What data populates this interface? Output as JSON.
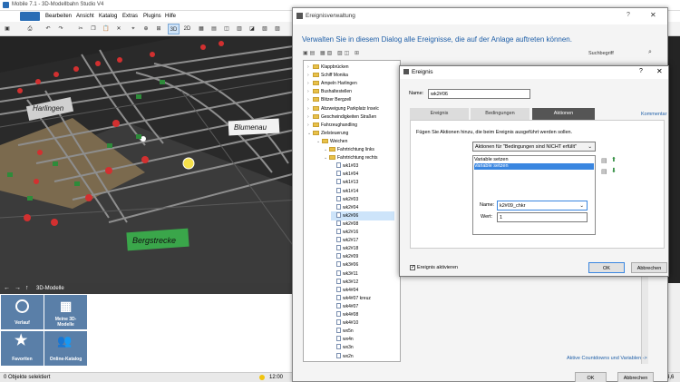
{
  "main": {
    "title": "Mobile 7.1 - 3D-Modellbahn Studio V4",
    "menu": [
      "Bearbeiten",
      "Ansicht",
      "Katalog",
      "Extras",
      "Plugins",
      "Hilfe"
    ],
    "toolbar": {
      "view3d": "3D",
      "view2d": "2D"
    },
    "scene_labels": {
      "harlingen": "Harlingen",
      "blumenau": "Blumenau",
      "bergstrecke": "Bergstrecke"
    },
    "nav_title": "3D-Modelle",
    "tiles": [
      {
        "label": "Verlauf",
        "icon": "clock-icon"
      },
      {
        "label": "Meine 3D-Modelle",
        "icon": "grid-icon"
      },
      {
        "label": "Favoriten",
        "icon": "star-icon"
      },
      {
        "label": "Online-Katalog",
        "icon": "users-icon"
      }
    ],
    "status": {
      "selected": "0 Objekte selektiert",
      "time": "12:00",
      "zoom": "4,6"
    }
  },
  "dialog": {
    "title": "Ereignisverwaltung",
    "heading": "Verwalten Sie in diesem Dialog alle Ereignisse, die auf der Anlage auftreten können.",
    "search_label": "Suchbegriff",
    "tree": [
      {
        "label": "Klappbrücken",
        "level": 1,
        "type": "folder"
      },
      {
        "label": "Schiff Monika",
        "level": 1,
        "type": "folder"
      },
      {
        "label": "Ampeln Harlingen",
        "level": 1,
        "type": "folder"
      },
      {
        "label": "Bushaltestellen",
        "level": 1,
        "type": "folder"
      },
      {
        "label": "Blitzer Bergzell",
        "level": 1,
        "type": "folder"
      },
      {
        "label": "Abzweigung Parkplatz Inselc",
        "level": 1,
        "type": "folder"
      },
      {
        "label": "Geschwindigkeiten Straßen",
        "level": 1,
        "type": "folder"
      },
      {
        "label": "Fahrzeughandling",
        "level": 1,
        "type": "folder"
      },
      {
        "label": "Zielsteuerung",
        "level": 1,
        "type": "folder"
      },
      {
        "label": "Weichen",
        "level": 2,
        "type": "folder"
      },
      {
        "label": "Fahrtrichtung links",
        "level": 3,
        "type": "folder"
      },
      {
        "label": "Fahrtrichtung rechts",
        "level": 3,
        "type": "folder"
      },
      {
        "label": "wk1#03",
        "level": 4,
        "type": "file"
      },
      {
        "label": "wk1#04",
        "level": 4,
        "type": "file"
      },
      {
        "label": "wk1#13",
        "level": 4,
        "type": "file"
      },
      {
        "label": "wk1#14",
        "level": 4,
        "type": "file"
      },
      {
        "label": "wk2#03",
        "level": 4,
        "type": "file"
      },
      {
        "label": "wk2#04",
        "level": 4,
        "type": "file"
      },
      {
        "label": "wk2#06",
        "level": 4,
        "type": "file",
        "selected": true
      },
      {
        "label": "wk2#08",
        "level": 4,
        "type": "file"
      },
      {
        "label": "wk2#16",
        "level": 4,
        "type": "file"
      },
      {
        "label": "wk2#17",
        "level": 4,
        "type": "file"
      },
      {
        "label": "wk2#18",
        "level": 4,
        "type": "file"
      },
      {
        "label": "wk2#09",
        "level": 4,
        "type": "file"
      },
      {
        "label": "wk3#06",
        "level": 4,
        "type": "file"
      },
      {
        "label": "wk3#11",
        "level": 4,
        "type": "file"
      },
      {
        "label": "wk3#12",
        "level": 4,
        "type": "file"
      },
      {
        "label": "wk4#04",
        "level": 4,
        "type": "file"
      },
      {
        "label": "wk4#07 kreuz",
        "level": 4,
        "type": "file"
      },
      {
        "label": "wk4#07",
        "level": 4,
        "type": "file"
      },
      {
        "label": "wk4#08",
        "level": 4,
        "type": "file"
      },
      {
        "label": "wk4#10",
        "level": 4,
        "type": "file"
      },
      {
        "label": "wx5n",
        "level": 4,
        "type": "file"
      },
      {
        "label": "wx4n",
        "level": 4,
        "type": "file"
      },
      {
        "label": "wx3n",
        "level": 4,
        "type": "file"
      },
      {
        "label": "wx2n",
        "level": 4,
        "type": "file"
      }
    ],
    "link": "Aktive Countdowns und Variablen ->",
    "ok": "OK",
    "cancel": "Abbrechen"
  },
  "event": {
    "title": "Ereignis",
    "name_label": "Name:",
    "name_value": "wk2#06",
    "tabs": [
      "Ereignis",
      "Bedingungen",
      "Aktionen"
    ],
    "comment_link": "Kommentar",
    "hint": "Fügen Sie Aktionen hinzu, die beim Ereignis ausgeführt werden sollen.",
    "dropdown": "Aktionen für \"Bedingungen sind NICHT erfüllt\"",
    "actions": [
      "Variable setzen",
      "Variable setzen"
    ],
    "var_name_label": "Name:",
    "var_name_value": "k2#09_chkr",
    "value_label": "Wert:",
    "value_value": "1",
    "active_label": "Ereignis aktivieren",
    "ok": "OK",
    "cancel": "Abbrechen"
  }
}
